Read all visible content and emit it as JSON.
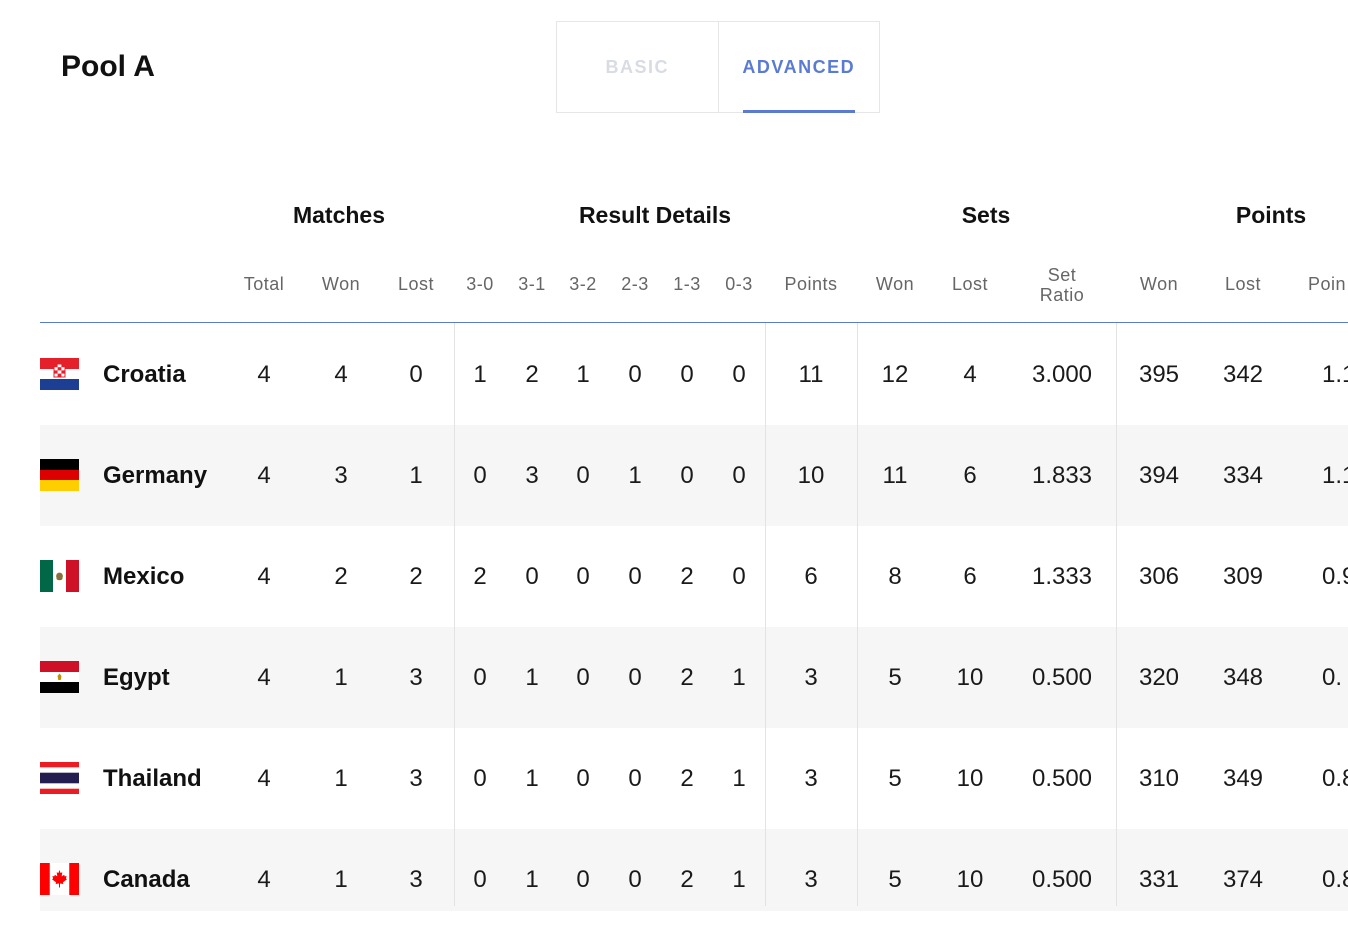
{
  "pool_title": "Pool A",
  "tabs": {
    "basic": "BASIC",
    "advanced": "ADVANCED"
  },
  "groups": {
    "matches": "Matches",
    "result_details": "Result Details",
    "sets": "Sets",
    "points": "Points"
  },
  "columns": {
    "total": "Total",
    "m_won": "Won",
    "m_lost": "Lost",
    "r30": "3-0",
    "r31": "3-1",
    "r32": "3-2",
    "r23": "2-3",
    "r13": "1-3",
    "r03": "0-3",
    "points": "Points",
    "s_won": "Won",
    "s_lost": "Lost",
    "set_ratio_1": "Set",
    "set_ratio_2": "Ratio",
    "p_won": "Won",
    "p_lost": "Lost",
    "p_ratio": "Poin"
  },
  "rows": [
    {
      "country": "Croatia",
      "flag": "croatia-flag-icon",
      "total": "4",
      "won": "4",
      "lost": "0",
      "r30": "1",
      "r31": "2",
      "r32": "1",
      "r23": "0",
      "r13": "0",
      "r03": "0",
      "points": "11",
      "sets_won": "12",
      "sets_lost": "4",
      "set_ratio": "3.000",
      "pts_won": "395",
      "pts_lost": "342",
      "pts_ratio": "1.1"
    },
    {
      "country": "Germany",
      "flag": "germany-flag-icon",
      "total": "4",
      "won": "3",
      "lost": "1",
      "r30": "0",
      "r31": "3",
      "r32": "0",
      "r23": "1",
      "r13": "0",
      "r03": "0",
      "points": "10",
      "sets_won": "11",
      "sets_lost": "6",
      "set_ratio": "1.833",
      "pts_won": "394",
      "pts_lost": "334",
      "pts_ratio": "1.1"
    },
    {
      "country": "Mexico",
      "flag": "mexico-flag-icon",
      "total": "4",
      "won": "2",
      "lost": "2",
      "r30": "2",
      "r31": "0",
      "r32": "0",
      "r23": "0",
      "r13": "2",
      "r03": "0",
      "points": "6",
      "sets_won": "8",
      "sets_lost": "6",
      "set_ratio": "1.333",
      "pts_won": "306",
      "pts_lost": "309",
      "pts_ratio": "0.9"
    },
    {
      "country": "Egypt",
      "flag": "egypt-flag-icon",
      "total": "4",
      "won": "1",
      "lost": "3",
      "r30": "0",
      "r31": "1",
      "r32": "0",
      "r23": "0",
      "r13": "2",
      "r03": "1",
      "points": "3",
      "sets_won": "5",
      "sets_lost": "10",
      "set_ratio": "0.500",
      "pts_won": "320",
      "pts_lost": "348",
      "pts_ratio": "0."
    },
    {
      "country": "Thailand",
      "flag": "thailand-flag-icon",
      "total": "4",
      "won": "1",
      "lost": "3",
      "r30": "0",
      "r31": "1",
      "r32": "0",
      "r23": "0",
      "r13": "2",
      "r03": "1",
      "points": "3",
      "sets_won": "5",
      "sets_lost": "10",
      "set_ratio": "0.500",
      "pts_won": "310",
      "pts_lost": "349",
      "pts_ratio": "0.8"
    },
    {
      "country": "Canada",
      "flag": "canada-flag-icon",
      "total": "4",
      "won": "1",
      "lost": "3",
      "r30": "0",
      "r31": "1",
      "r32": "0",
      "r23": "0",
      "r13": "2",
      "r03": "1",
      "points": "3",
      "sets_won": "5",
      "sets_lost": "10",
      "set_ratio": "0.500",
      "pts_won": "331",
      "pts_lost": "374",
      "pts_ratio": "0.8"
    }
  ]
}
